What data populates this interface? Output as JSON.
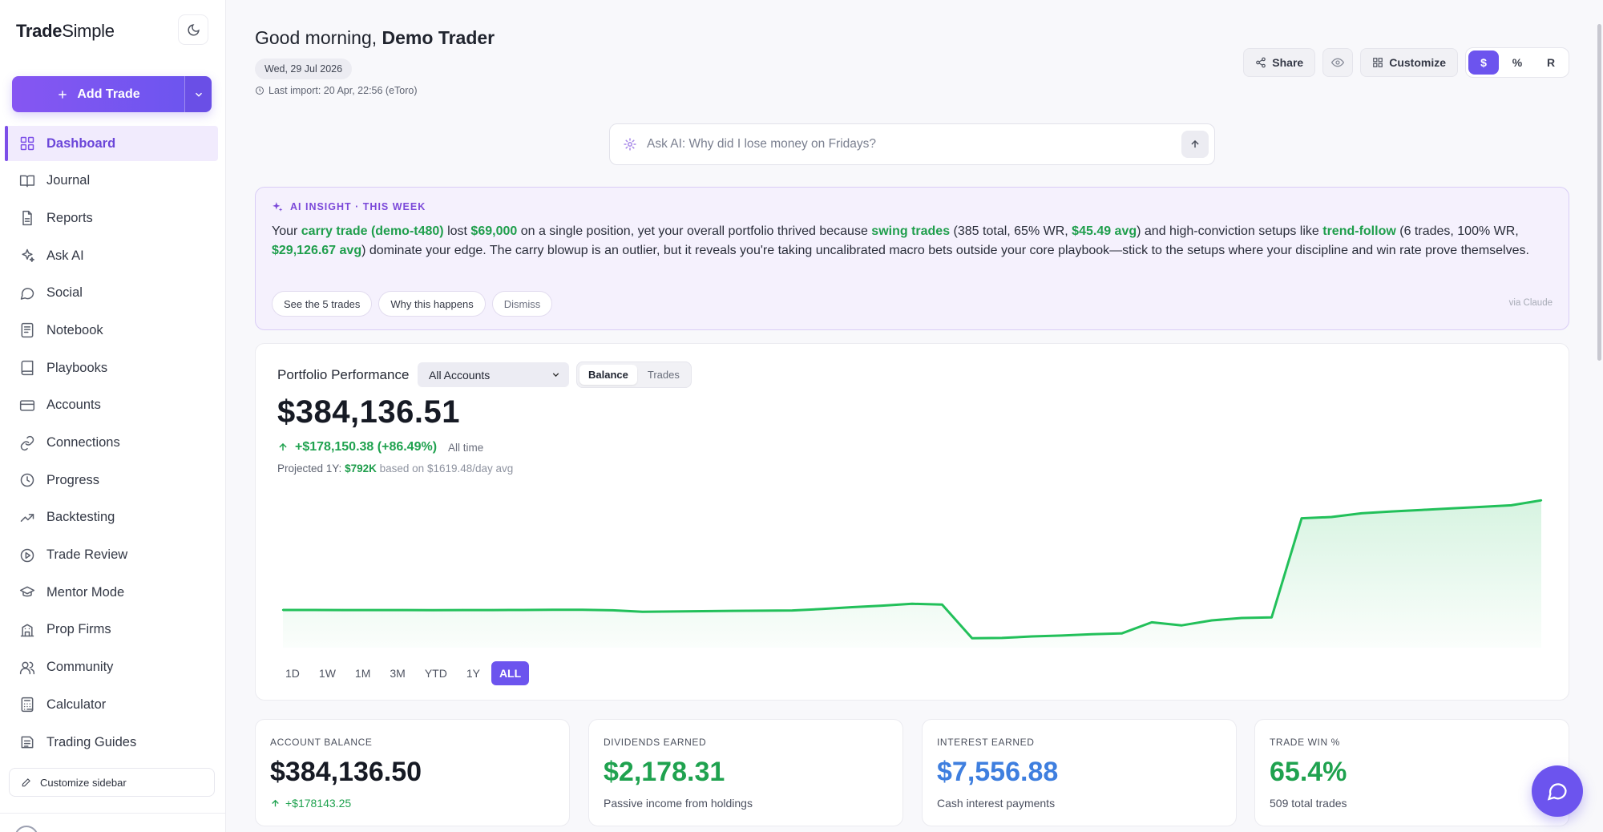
{
  "brand": {
    "name_bold": "Trade",
    "name_light": "Simple"
  },
  "sidebar": {
    "add_trade_label": "Add Trade",
    "items": [
      {
        "label": "Dashboard",
        "icon": "grid-icon",
        "active": true
      },
      {
        "label": "Journal",
        "icon": "book-open-icon"
      },
      {
        "label": "Reports",
        "icon": "document-icon"
      },
      {
        "label": "Ask AI",
        "icon": "sparkle-icon"
      },
      {
        "label": "Social",
        "icon": "chat-bubble-icon"
      },
      {
        "label": "Notebook",
        "icon": "notebook-icon"
      },
      {
        "label": "Playbooks",
        "icon": "book-icon"
      },
      {
        "label": "Accounts",
        "icon": "card-icon"
      },
      {
        "label": "Connections",
        "icon": "link-icon"
      },
      {
        "label": "Progress",
        "icon": "clock-icon"
      },
      {
        "label": "Backtesting",
        "icon": "trend-icon"
      },
      {
        "label": "Trade Review",
        "icon": "play-circle-icon"
      },
      {
        "label": "Mentor Mode",
        "icon": "graduation-cap-icon"
      },
      {
        "label": "Prop Firms",
        "icon": "building-icon"
      },
      {
        "label": "Community",
        "icon": "users-icon"
      },
      {
        "label": "Calculator",
        "icon": "calculator-icon"
      },
      {
        "label": "Trading Guides",
        "icon": "guide-icon"
      }
    ],
    "customize_label": "Customize sidebar"
  },
  "header": {
    "greeting": "Good morning,",
    "user_name": "Demo Trader",
    "date": "Wed, 29 Jul 2026",
    "last_import": "Last import: 20 Apr, 22:56 (eToro)",
    "share_label": "Share",
    "customize_label": "Customize",
    "units": [
      "$",
      "%",
      "R"
    ],
    "active_unit": "$"
  },
  "ask": {
    "placeholder": "Ask AI: Why did I lose money on Fridays?"
  },
  "insight": {
    "heading": "AI INSIGHT · THIS WEEK",
    "t1": "Your ",
    "h1": "carry trade (demo-t480)",
    "t2": " lost ",
    "h2": "$69,000",
    "t3": " on a single position, yet your overall portfolio thrived because ",
    "h3": "swing trades",
    "t4": " (385 total, 65% WR, ",
    "h4": "$45.49 avg",
    "t5": ") and high-conviction setups like ",
    "h5": "trend-follow",
    "t6": " (6 trades, 100% WR, ",
    "h6": "$29,126.67 avg",
    "t7": ") dominate your edge. The carry blowup is an outlier, but it reveals you're taking uncalibrated macro bets outside your core playbook—stick to the setups where your discipline and win rate prove themselves.",
    "actions": [
      "See the 5 trades",
      "Why this happens",
      "Dismiss"
    ],
    "via": "via Claude"
  },
  "performance": {
    "title": "Portfolio Performance",
    "account": "All Accounts",
    "views": [
      "Balance",
      "Trades"
    ],
    "active_view": "Balance",
    "balance": "$384,136.51",
    "change": "+$178,150.38 (+86.49%)",
    "change_period": "All time",
    "projected_label": "Projected 1Y:",
    "projected_value": "$792K",
    "projected_basis": "based on $1619.48/day avg",
    "ranges": [
      "1D",
      "1W",
      "1M",
      "3M",
      "YTD",
      "1Y",
      "ALL"
    ],
    "active_range": "ALL",
    "line_color": "#22c05a"
  },
  "chart_data": {
    "type": "area",
    "series": [
      {
        "values": [
          206000,
          206000,
          205900,
          205800,
          205900,
          205700,
          205800,
          205900,
          206000,
          206200,
          206400,
          205500,
          203000,
          203500,
          204000,
          204500,
          204800,
          205200,
          207500,
          210500,
          213000,
          216000,
          214800,
          160000,
          160500,
          163000,
          164500,
          166500,
          168000,
          186000,
          181000,
          189000,
          193000,
          194000,
          355000,
          357000,
          363000,
          366000,
          368500,
          371000,
          373500,
          376000,
          384136
        ]
      }
    ],
    "ylim": [
      150000,
      400000
    ],
    "grid": false,
    "legend": "none"
  },
  "stats": [
    {
      "label": "ACCOUNT BALANCE",
      "value": "$384,136.50",
      "sub": "+$178143.25",
      "color": "#161a24"
    },
    {
      "label": "DIVIDENDS EARNED",
      "value": "$2,178.31",
      "sub": "Passive income from holdings",
      "color": "#1fa24f"
    },
    {
      "label": "INTEREST EARNED",
      "value": "$7,556.88",
      "sub": "Cash interest payments",
      "color": "#3f7fdf"
    },
    {
      "label": "TRADE WIN %",
      "value": "65.4%",
      "sub": "509 total trades",
      "color": "#1fa24f"
    }
  ]
}
